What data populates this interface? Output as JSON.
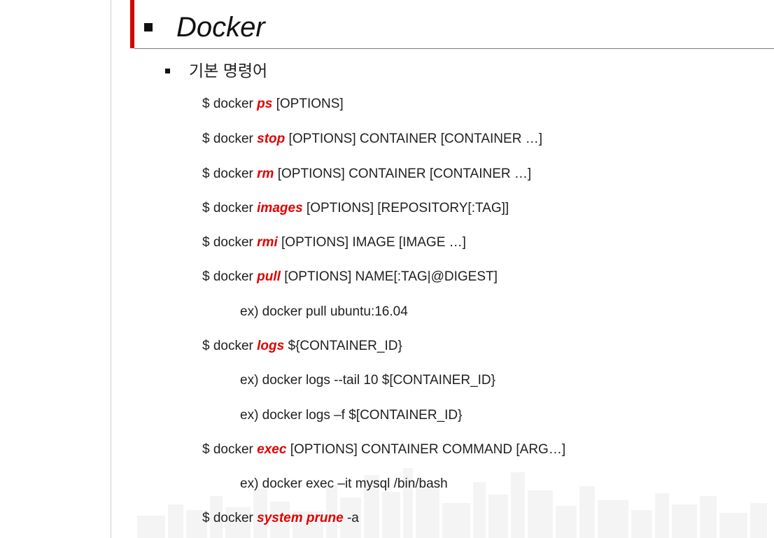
{
  "slide": {
    "title": "Docker",
    "section_heading": "기본 명령어"
  },
  "commands": [
    {
      "prefix": "$ docker ",
      "keyword": "ps",
      "suffix": " [OPTIONS]"
    },
    {
      "prefix": "$ docker ",
      "keyword": "stop",
      "suffix": " [OPTIONS] CONTAINER [CONTAINER …]"
    },
    {
      "prefix": "$ docker ",
      "keyword": "rm",
      "suffix": " [OPTIONS] CONTAINER [CONTAINER …]"
    },
    {
      "prefix": "$ docker ",
      "keyword": "images",
      "suffix": " [OPTIONS] [REPOSITORY[:TAG]]"
    },
    {
      "prefix": "$ docker ",
      "keyword": "rmi",
      "suffix": " [OPTIONS] IMAGE [IMAGE …]"
    },
    {
      "prefix": "$ docker ",
      "keyword": "pull",
      "suffix": " [OPTIONS] NAME[:TAG|@DIGEST]"
    },
    {
      "text": "ex) docker pull ubuntu:16.04"
    },
    {
      "prefix": "$ docker ",
      "keyword": "logs",
      "suffix": " ${CONTAINER_ID}"
    },
    {
      "text": "ex) docker logs --tail 10 $[CONTAINER_ID}"
    },
    {
      "text": "ex) docker logs –f $[CONTAINER_ID}"
    },
    {
      "prefix": "$ docker ",
      "keyword": "exec",
      "suffix": " [OPTIONS] CONTAINER COMMAND [ARG…]"
    },
    {
      "text": "ex) docker exec –it mysql /bin/bash"
    },
    {
      "prefix": "$ docker ",
      "keyword": "system prune",
      "suffix": " -a"
    }
  ],
  "colors": {
    "accent_red": "#d40000",
    "keyword_red": "#e00000",
    "text": "#1f1f1f",
    "watermark": "#f3f3f3"
  }
}
